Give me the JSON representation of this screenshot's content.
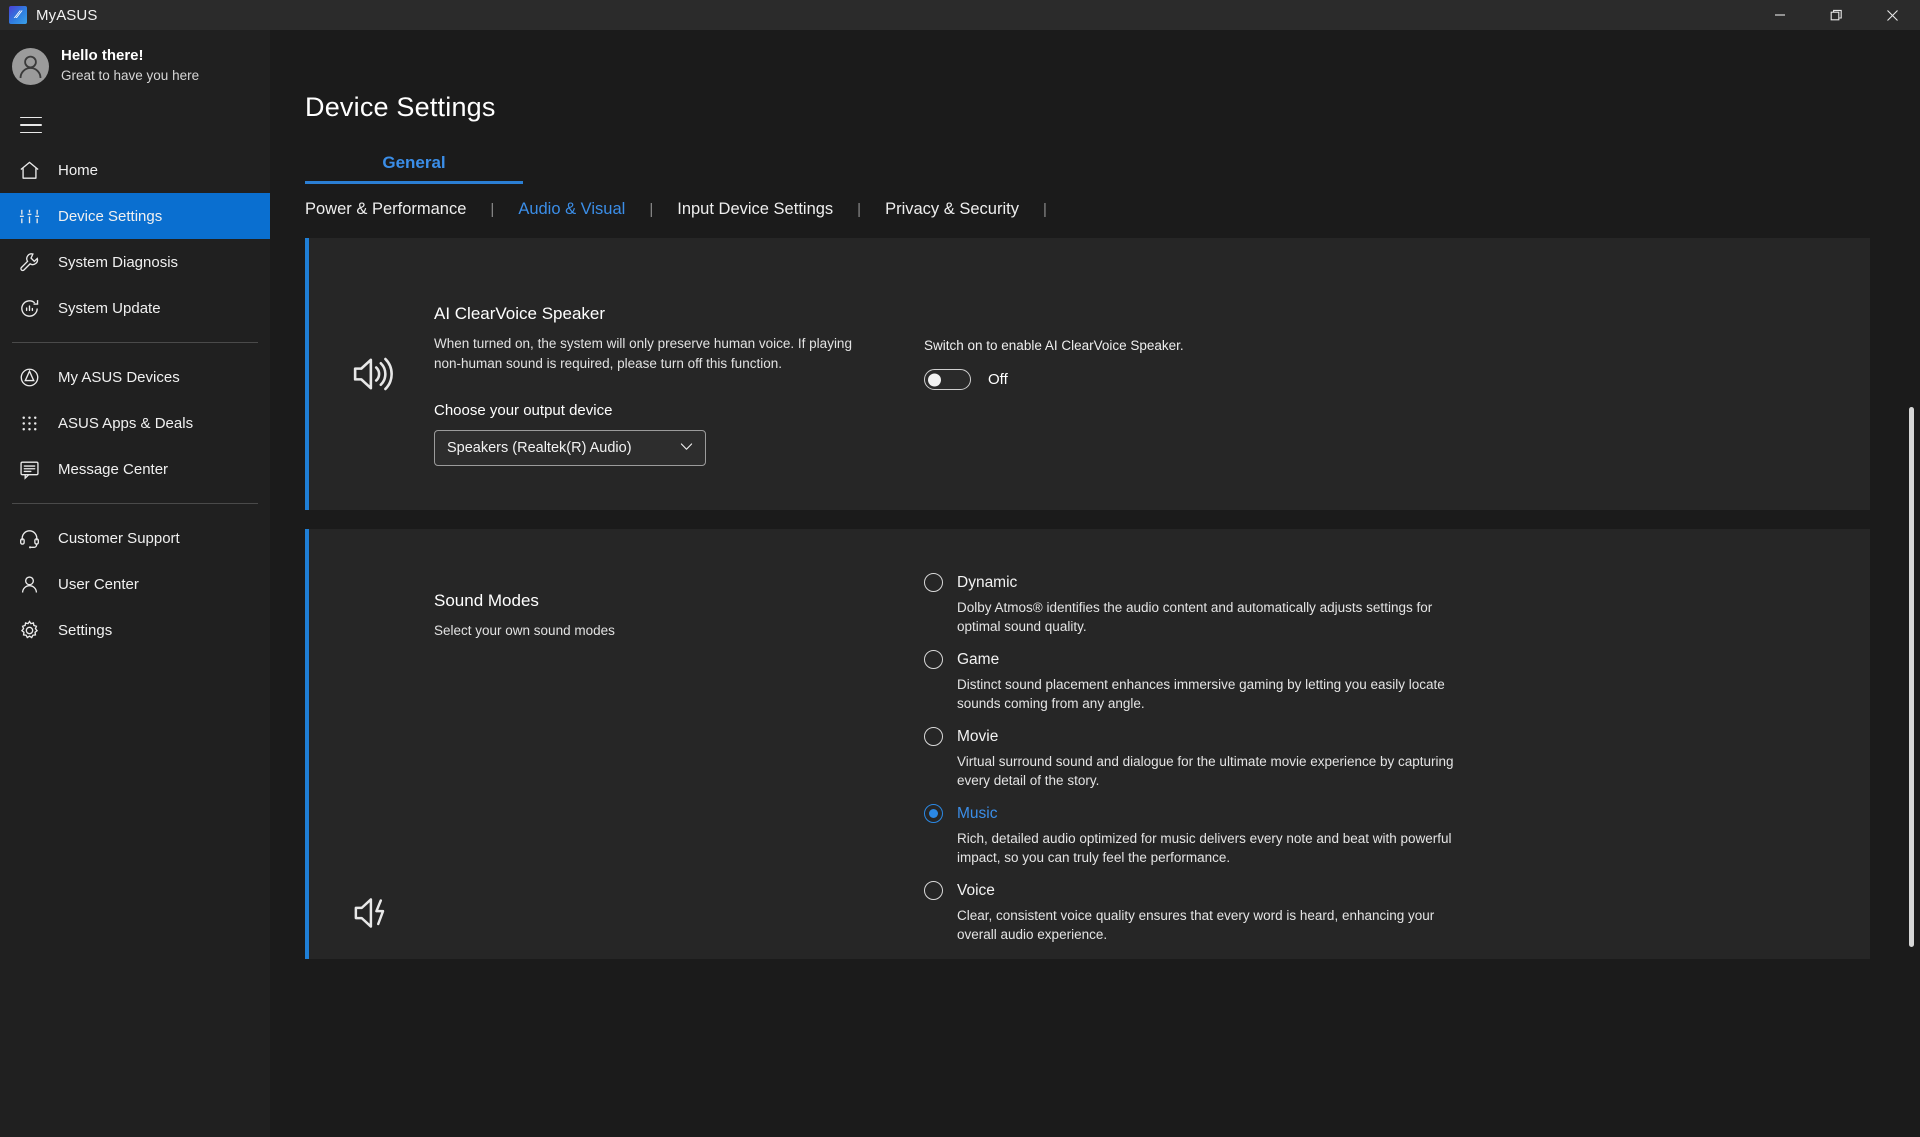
{
  "window": {
    "app_name": "MyASUS",
    "logo_glyph": "⁄⁄",
    "minimize_label": "–",
    "maximize_label": "❐",
    "close_label": "✕"
  },
  "sidebar": {
    "greeting_title": "Hello there!",
    "greeting_subtitle": "Great to have you here",
    "menu_toggle_name": "hamburger-menu",
    "groups": [
      {
        "items": [
          {
            "label": "Home",
            "icon": "home-icon",
            "active": false
          },
          {
            "label": "Device Settings",
            "icon": "sliders-icon",
            "active": true
          },
          {
            "label": "System Diagnosis",
            "icon": "wrench-icon",
            "active": false
          },
          {
            "label": "System Update",
            "icon": "update-icon",
            "active": false
          }
        ]
      },
      {
        "items": [
          {
            "label": "My ASUS Devices",
            "icon": "asus-devices-icon",
            "active": false
          },
          {
            "label": "ASUS Apps & Deals",
            "icon": "grid-dots-icon",
            "active": false
          },
          {
            "label": "Message Center",
            "icon": "message-icon",
            "active": false
          }
        ]
      },
      {
        "items": [
          {
            "label": "Customer Support",
            "icon": "headset-icon",
            "active": false
          },
          {
            "label": "User Center",
            "icon": "user-icon",
            "active": false
          },
          {
            "label": "Settings",
            "icon": "gear-icon",
            "active": false
          }
        ]
      }
    ]
  },
  "main": {
    "page_title": "Device Settings",
    "primary_tab": "General",
    "secondary_tabs": [
      {
        "label": "Power & Performance",
        "active": false
      },
      {
        "label": "Audio & Visual",
        "active": true
      },
      {
        "label": "Input Device Settings",
        "active": false
      },
      {
        "label": "Privacy & Security",
        "active": false
      }
    ],
    "tab_divider": "|"
  },
  "clearvoice": {
    "icon": "speaker-volume-icon",
    "title": "AI ClearVoice Speaker",
    "description": "When turned on, the system will only preserve human voice. If playing non-human sound is required, please turn off this function.",
    "choose_label": "Choose your output device",
    "selected_device": "Speakers (Realtek(R) Audio)",
    "dropdown_icon": "chevron-down-icon",
    "switch_caption": "Switch on to enable AI ClearVoice Speaker.",
    "switch_state": "Off",
    "switch_on": false
  },
  "sound_modes": {
    "icon": "speaker-effects-icon",
    "title": "Sound Modes",
    "subtitle": "Select your own sound modes",
    "options": [
      {
        "label": "Dynamic",
        "description": "Dolby Atmos® identifies the audio content and automatically adjusts settings for optimal sound quality.",
        "selected": false
      },
      {
        "label": "Game",
        "description": "Distinct sound placement enhances immersive gaming by letting you easily locate sounds coming from any angle.",
        "selected": false
      },
      {
        "label": "Movie",
        "description": "Virtual surround sound and dialogue for the ultimate movie experience by capturing every detail of the story.",
        "selected": false
      },
      {
        "label": "Music",
        "description": "Rich, detailed audio optimized for music delivers every note and beat with powerful impact, so you can truly feel the performance.",
        "selected": true
      },
      {
        "label": "Voice",
        "description": "Clear, consistent voice quality ensures that every word is heard, enhancing your overall audio experience.",
        "selected": false
      }
    ]
  },
  "colors": {
    "accent_blue": "#2b7fd4",
    "link_blue": "#3b8ee8",
    "card_bg": "#262626",
    "sidebar_bg": "#202020",
    "page_bg": "#1b1b1b"
  }
}
